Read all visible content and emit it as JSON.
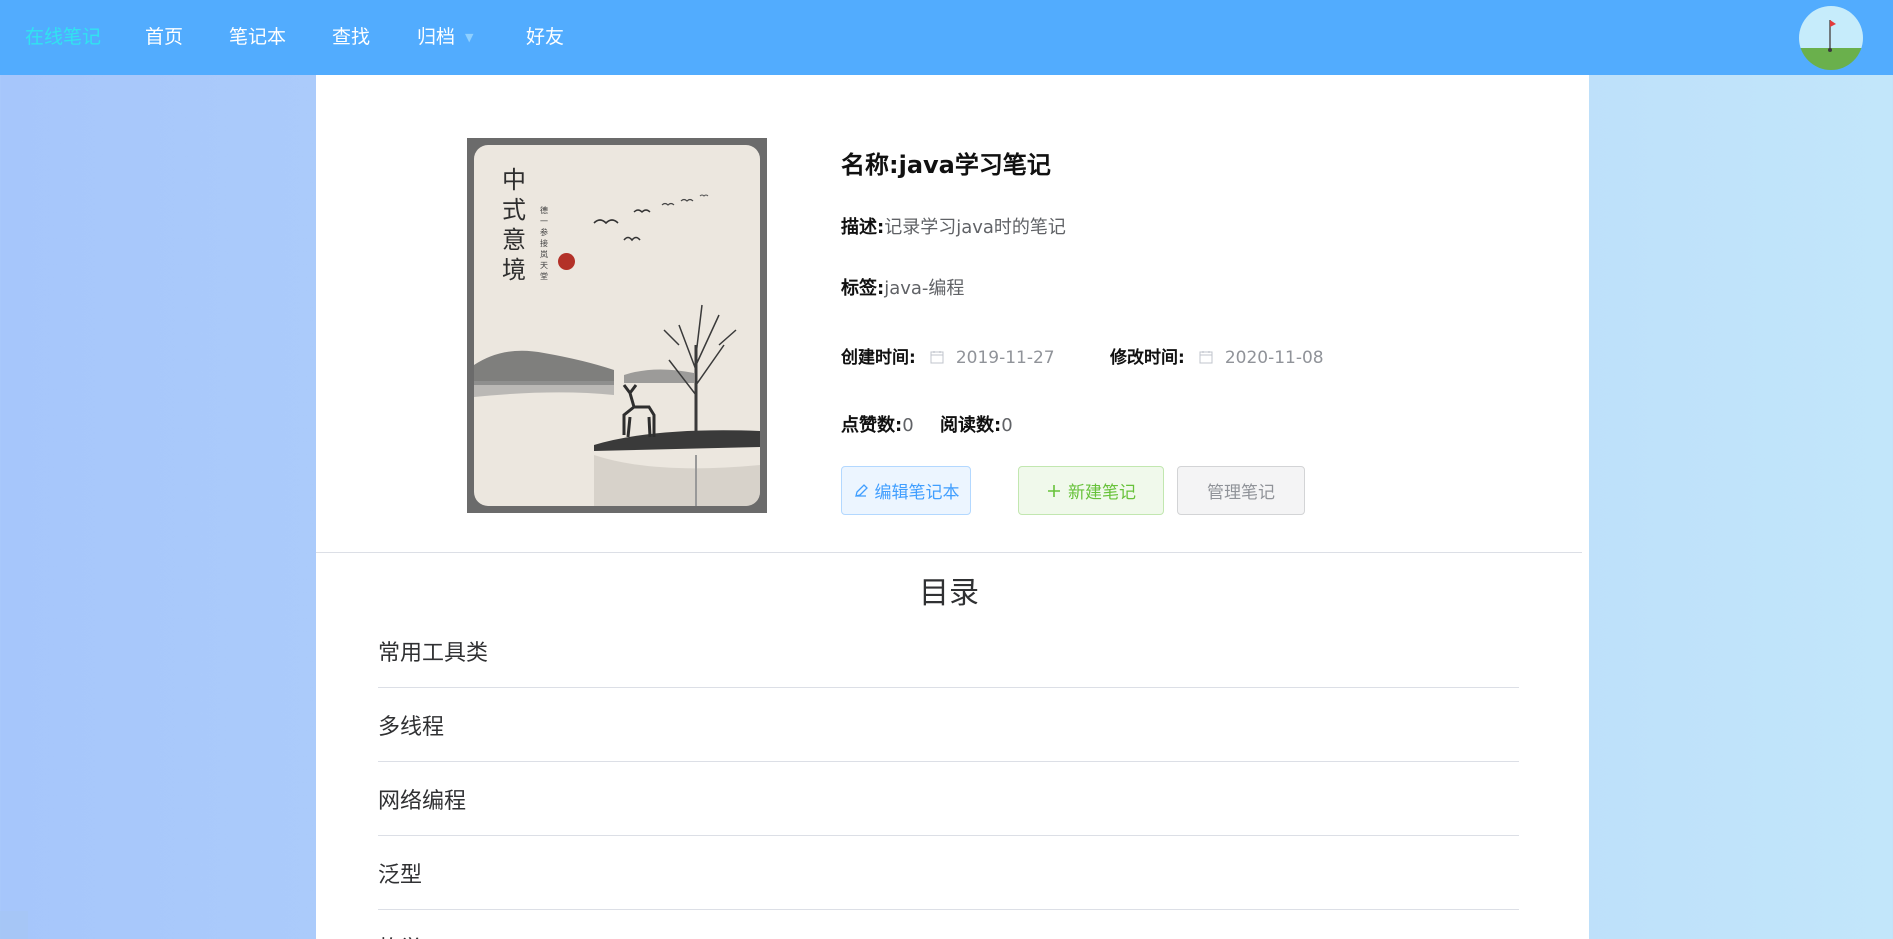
{
  "nav": {
    "brand": "在线笔记",
    "items": [
      "首页",
      "笔记本",
      "查找",
      "归档",
      "好友"
    ]
  },
  "notebook": {
    "name_label": "名称:",
    "name": "java学习笔记",
    "desc_label": "描述:",
    "desc": "记录学习java时的笔记",
    "tags_label": "标签:",
    "tags": "java-编程",
    "created_label": "创建时间:",
    "created": "2019-11-27",
    "modified_label": "修改时间:",
    "modified": "2020-11-08",
    "likes_label": "点赞数:",
    "likes": "0",
    "reads_label": "阅读数:",
    "reads": "0",
    "cover": {
      "title": "中式意境",
      "subtitle": "德一参接岚天堂"
    }
  },
  "buttons": {
    "edit": "编辑笔记本",
    "new": "新建笔记",
    "manage": "管理笔记"
  },
  "toc": {
    "title": "目录",
    "items": [
      "常用工具类",
      "多线程",
      "网络编程",
      "泛型",
      "枚举"
    ]
  },
  "colors": {
    "nav_bg": "#52acfe",
    "nav_active": "#31e3f0",
    "primary": "#409eff",
    "success": "#67c23a",
    "info": "#909399"
  }
}
